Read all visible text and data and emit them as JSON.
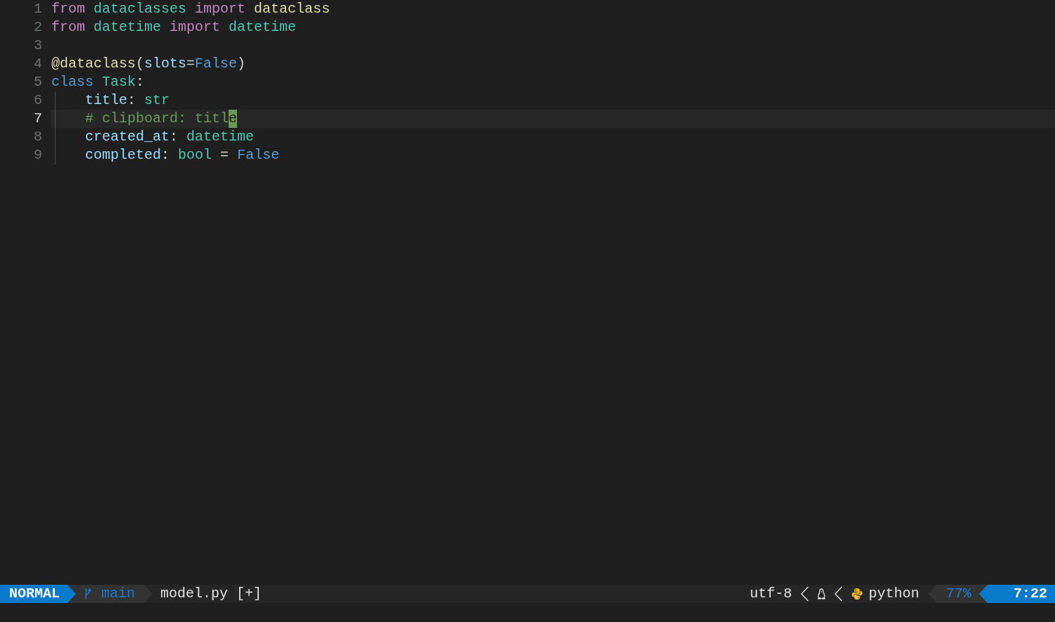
{
  "editor": {
    "lines": [
      {
        "number": "1",
        "current": false,
        "words": [
          [
            {
              "text": "from",
              "kind": "keyword"
            }
          ],
          [
            {
              "text": "dataclasses",
              "kind": "module"
            }
          ],
          [
            {
              "text": "import",
              "kind": "keyword"
            }
          ],
          [
            {
              "text": "dataclass",
              "kind": "function"
            }
          ]
        ]
      },
      {
        "number": "2",
        "current": false,
        "words": [
          [
            {
              "text": "from",
              "kind": "keyword"
            }
          ],
          [
            {
              "text": "datetime",
              "kind": "module"
            }
          ],
          [
            {
              "text": "import",
              "kind": "keyword"
            }
          ],
          [
            {
              "text": "datetime",
              "kind": "module"
            }
          ]
        ]
      },
      {
        "number": "3",
        "current": false
      },
      {
        "number": "4",
        "current": false,
        "words": [
          [
            {
              "text": "@dataclass",
              "kind": "function"
            },
            {
              "text": "(",
              "kind": "punctuation"
            },
            {
              "text": "slots",
              "kind": "variable"
            },
            {
              "text": "=",
              "kind": "punctuation"
            },
            {
              "text": "False",
              "kind": "constant"
            },
            {
              "text": ")",
              "kind": "punctuation"
            }
          ]
        ]
      },
      {
        "number": "5",
        "current": false,
        "words": [
          [
            {
              "text": "class",
              "kind": "storage"
            }
          ],
          [
            {
              "text": "Task",
              "kind": "module"
            },
            {
              "text": ":",
              "kind": "punctuation"
            }
          ]
        ],
        "children": [
          {
            "number": "6",
            "current": false,
            "words": [
              [
                {
                  "text": "title",
                  "kind": "variable"
                },
                {
                  "text": ":",
                  "kind": "punctuation"
                }
              ],
              [
                {
                  "text": "str",
                  "kind": "module"
                }
              ]
            ]
          },
          {
            "number": "7",
            "current": true,
            "words": [
              [
                {
                  "text": "# clipboard: titl",
                  "kind": "comment"
                },
                {
                  "text": "e",
                  "kind": "cursor"
                }
              ]
            ]
          },
          {
            "number": "8",
            "current": false,
            "words": [
              [
                {
                  "text": "created_at",
                  "kind": "variable"
                },
                {
                  "text": ":",
                  "kind": "punctuation"
                }
              ],
              [
                {
                  "text": "datetime",
                  "kind": "module"
                }
              ]
            ]
          },
          {
            "number": "9",
            "current": false,
            "words": [
              [
                {
                  "text": "completed",
                  "kind": "variable"
                },
                {
                  "text": ":",
                  "kind": "punctuation"
                }
              ],
              [
                {
                  "text": "bool",
                  "kind": "module"
                }
              ],
              [
                {
                  "text": "=",
                  "kind": "punctuation"
                }
              ],
              [
                {
                  "text": "False",
                  "kind": "constant"
                }
              ]
            ]
          }
        ]
      }
    ]
  },
  "status_line": {
    "mode": "NORMAL",
    "branch": "main",
    "file_name": "model.py",
    "modified_marker": "[+]",
    "encoding": "utf-8",
    "file_type": "python",
    "progress": "77%",
    "position": "7:22"
  }
}
